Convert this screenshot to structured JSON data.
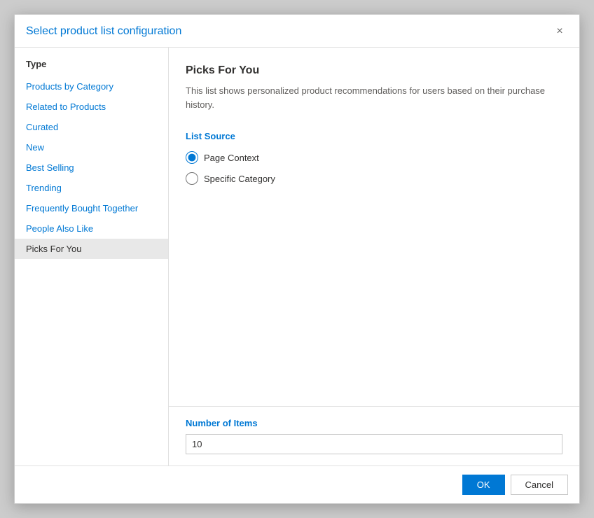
{
  "dialog": {
    "title": "Select product list configuration",
    "close_label": "×"
  },
  "sidebar": {
    "header": "Type",
    "items": [
      {
        "id": "products-by-category",
        "label": "Products by Category",
        "active": false
      },
      {
        "id": "related-to-products",
        "label": "Related to Products",
        "active": false
      },
      {
        "id": "curated",
        "label": "Curated",
        "active": false
      },
      {
        "id": "new",
        "label": "New",
        "active": false
      },
      {
        "id": "best-selling",
        "label": "Best Selling",
        "active": false
      },
      {
        "id": "trending",
        "label": "Trending",
        "active": false
      },
      {
        "id": "frequently-bought-together",
        "label": "Frequently Bought Together",
        "active": false
      },
      {
        "id": "people-also-like",
        "label": "People Also Like",
        "active": false
      },
      {
        "id": "picks-for-you",
        "label": "Picks For You",
        "active": true
      }
    ]
  },
  "content": {
    "title": "Picks For You",
    "description": "This list shows personalized product recommendations for users based on their purchase history.",
    "list_source_label": "List Source",
    "radio_options": [
      {
        "id": "page-context",
        "label": "Page Context",
        "checked": true
      },
      {
        "id": "specific-category",
        "label": "Specific Category",
        "checked": false
      }
    ]
  },
  "footer": {
    "number_of_items_label": "Number of Items",
    "number_of_items_value": "10",
    "ok_label": "OK",
    "cancel_label": "Cancel"
  }
}
